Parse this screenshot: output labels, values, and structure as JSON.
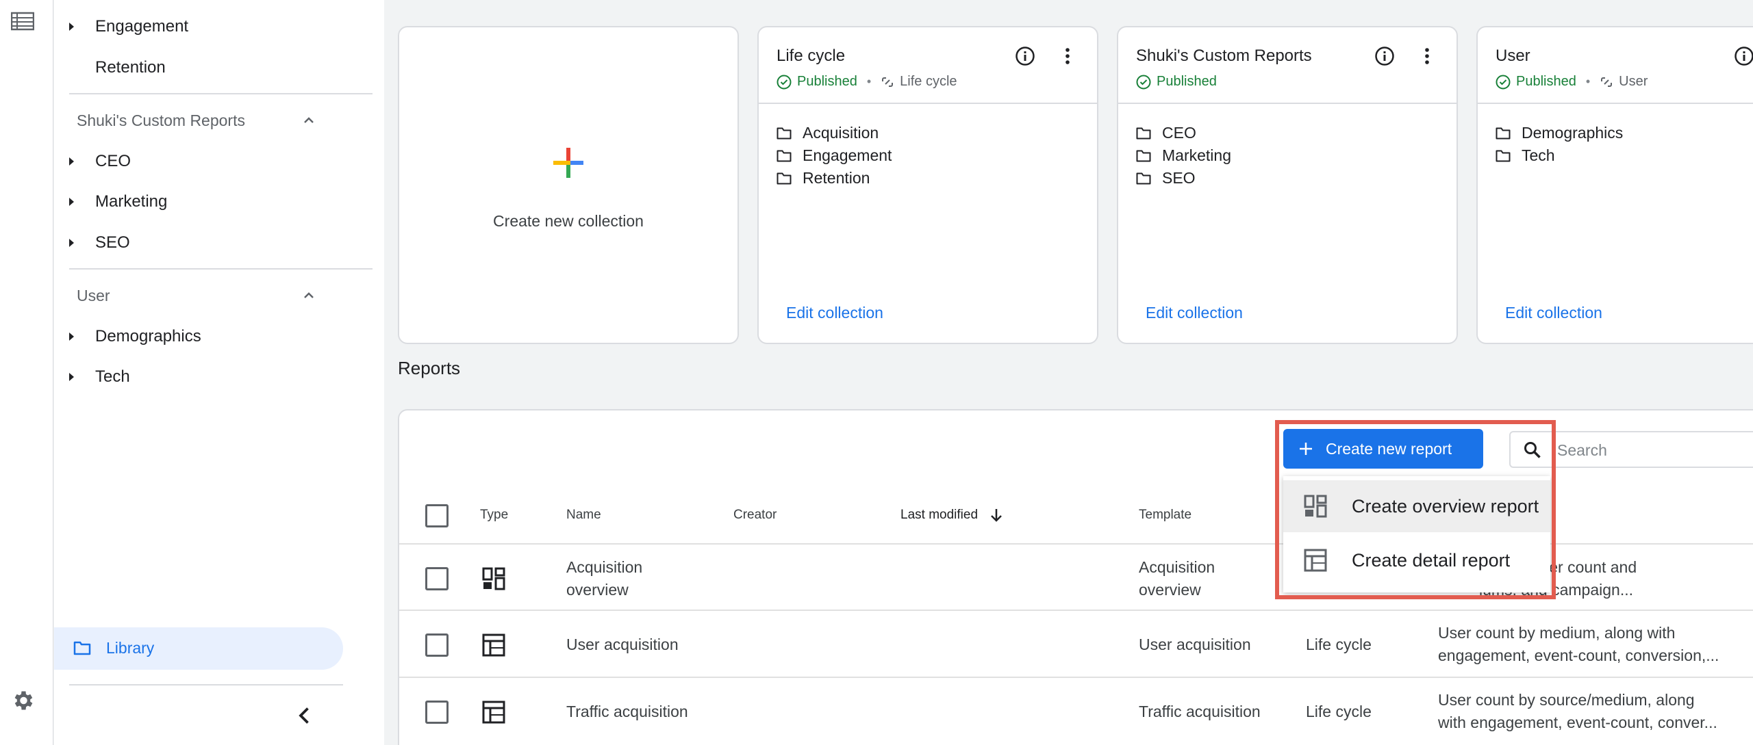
{
  "rail": {
    "menu_icon": "report-list-icon",
    "settings_icon": "gear-icon"
  },
  "sidebar": {
    "items_top": [
      {
        "label": "Engagement",
        "has_caret": true
      },
      {
        "label": "Retention",
        "has_caret": false
      }
    ],
    "sections": [
      {
        "title": "Shuki's Custom Reports",
        "items": [
          "CEO",
          "Marketing",
          "SEO"
        ]
      },
      {
        "title": "User",
        "items": [
          "Demographics",
          "Tech"
        ]
      }
    ],
    "library_label": "Library"
  },
  "collections": {
    "new_label": "Create new collection",
    "cards": [
      {
        "title": "Life cycle",
        "status": "Published",
        "template": "Life cycle",
        "folders": [
          "Acquisition",
          "Engagement",
          "Retention"
        ],
        "edit_label": "Edit collection"
      },
      {
        "title": "Shuki's Custom Reports",
        "status": "Published",
        "template": "",
        "folders": [
          "CEO",
          "Marketing",
          "SEO"
        ],
        "edit_label": "Edit collection"
      },
      {
        "title": "User",
        "status": "Published",
        "template": "User",
        "folders": [
          "Demographics",
          "Tech"
        ],
        "edit_label": "Edit collection"
      }
    ]
  },
  "reports": {
    "title": "Reports",
    "create_button": "Create new report",
    "search_placeholder": "Search",
    "columns": {
      "type": "Type",
      "name": "Name",
      "creator": "Creator",
      "last_modified": "Last modified",
      "template": "Template"
    },
    "rows": [
      {
        "type": "overview",
        "name": "Acquisition overview",
        "template": "Acquisition overview",
        "collection": "",
        "desc1": "view of user count and",
        "desc2": "iums, and campaign..."
      },
      {
        "type": "detail",
        "name": "User acquisition",
        "template": "User acquisition",
        "collection": "Life cycle",
        "desc1": "User count by medium, along with",
        "desc2": "engagement, event-count, conversion,..."
      },
      {
        "type": "detail",
        "name": "Traffic acquisition",
        "template": "Traffic acquisition",
        "collection": "Life cycle",
        "desc1": "User count by source/medium, along",
        "desc2": "with engagement, event-count, conver..."
      }
    ]
  },
  "create_menu": {
    "items": [
      {
        "label": "Create overview report",
        "icon": "overview-report-icon"
      },
      {
        "label": "Create detail report",
        "icon": "detail-report-icon"
      }
    ]
  },
  "colors": {
    "accent": "#1a73e8",
    "published": "#188038",
    "highlight": "#e25c4f",
    "library_bg": "#e8f0fe"
  }
}
